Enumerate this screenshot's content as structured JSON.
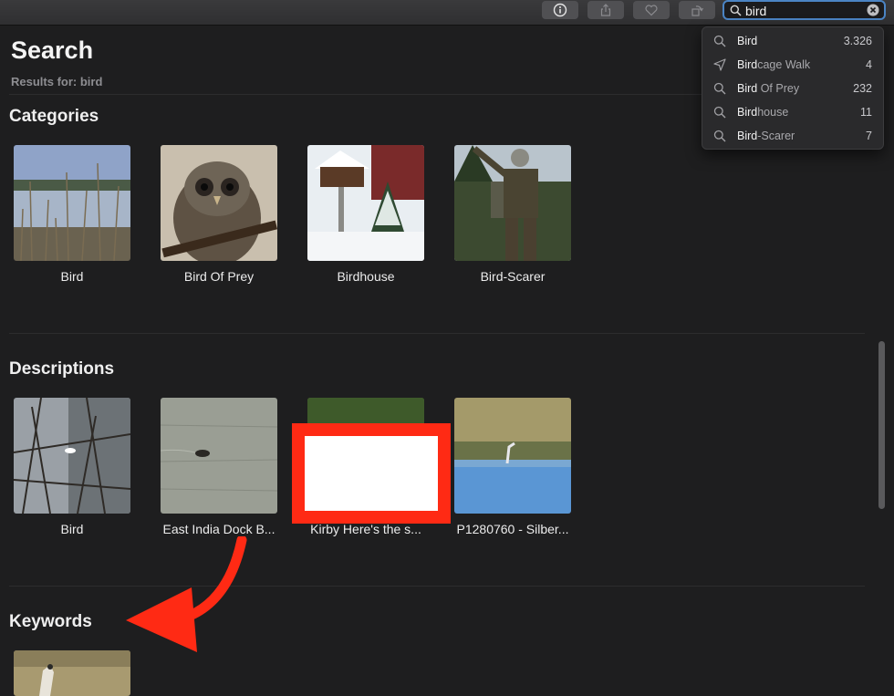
{
  "toolbar": {
    "buttons": [
      {
        "name": "info-button",
        "icon": "info-icon"
      },
      {
        "name": "share-button",
        "icon": "share-icon"
      },
      {
        "name": "favorite-button",
        "icon": "heart-icon"
      },
      {
        "name": "rotate-button",
        "icon": "rotate-icon"
      }
    ],
    "search_value": "bird"
  },
  "suggestions": [
    {
      "icon": "search-icon",
      "match": "Bird",
      "rest": "",
      "count": "3.326"
    },
    {
      "icon": "location-icon",
      "match": "Bird",
      "rest": "cage Walk",
      "count": "4"
    },
    {
      "icon": "search-icon",
      "match": "Bird",
      "rest": " Of Prey",
      "count": "232"
    },
    {
      "icon": "search-icon",
      "match": "Bird",
      "rest": "house",
      "count": "11"
    },
    {
      "icon": "search-icon",
      "match": "Bird",
      "rest": "-Scarer",
      "count": "7"
    }
  ],
  "header": {
    "title": "Search",
    "subtitle": "Results for: bird"
  },
  "sections": {
    "categories": {
      "title": "Categories",
      "items": [
        "Bird",
        "Bird Of Prey",
        "Birdhouse",
        "Bird-Scarer"
      ]
    },
    "descriptions": {
      "title": "Descriptions",
      "items": [
        "Bird",
        "East India Dock B...",
        "Kirby Here's the s...",
        "P1280760 - Silber..."
      ]
    },
    "keywords": {
      "title": "Keywords",
      "items": [
        ""
      ]
    }
  },
  "colors": {
    "background": "#1e1e1f",
    "accent": "#4b84c4",
    "annotation": "#ff2a14"
  }
}
